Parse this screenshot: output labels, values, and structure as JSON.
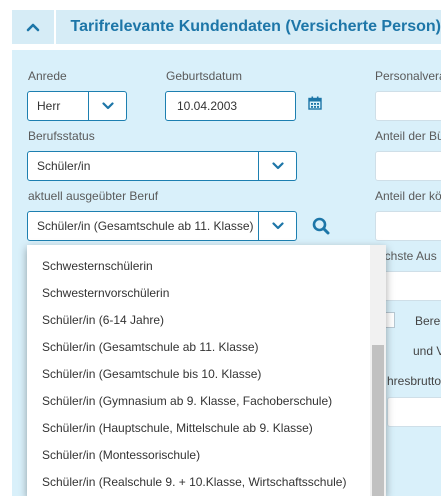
{
  "section": {
    "title": "Tarifrelevante Kundendaten (Versicherte Person)"
  },
  "form": {
    "anrede_label": "Anrede",
    "anrede_value": "Herr",
    "geburtsdatum_label": "Geburtsdatum",
    "geburtsdatum_value": "10.04.2003",
    "berufsstatus_label": "Berufsstatus",
    "berufsstatus_value": "Schüler/in",
    "beruf_label": "aktuell ausgeübter Beruf",
    "beruf_value": "Schüler/in (Gesamtschule ab 11. Klasse)"
  },
  "right_column": {
    "label1": "Personalvera",
    "label2": "Anteil der Bü",
    "label3": "Anteil der kö",
    "label4": "öchste Aus",
    "text1": "Bere",
    "text2": "und V",
    "text3": "hresbrutto"
  },
  "dropdown": {
    "items": [
      "Schwesternschülerin",
      "Schwesternvorschülerin",
      "Schüler/in (6-14 Jahre)",
      "Schüler/in (Gesamtschule ab 11. Klasse)",
      "Schüler/in (Gesamtschule bis 10. Klasse)",
      "Schüler/in (Gymnasium ab 9. Klasse, Fachoberschule)",
      "Schüler/in (Hauptschule, Mittelschule ab 9. Klasse)",
      "Schüler/in (Montessorischule)",
      "Schüler/in (Realschule 9. + 10.Klasse, Wirtschaftsschule)"
    ]
  },
  "colors": {
    "accent": "#1d76a8",
    "panel": "#d9f0fa",
    "header": "#d6ecf6"
  },
  "icons": {
    "collapse": "chevron-up-icon",
    "calendar": "calendar-icon",
    "search": "search-icon",
    "dropdown": "chevron-down-icon"
  }
}
